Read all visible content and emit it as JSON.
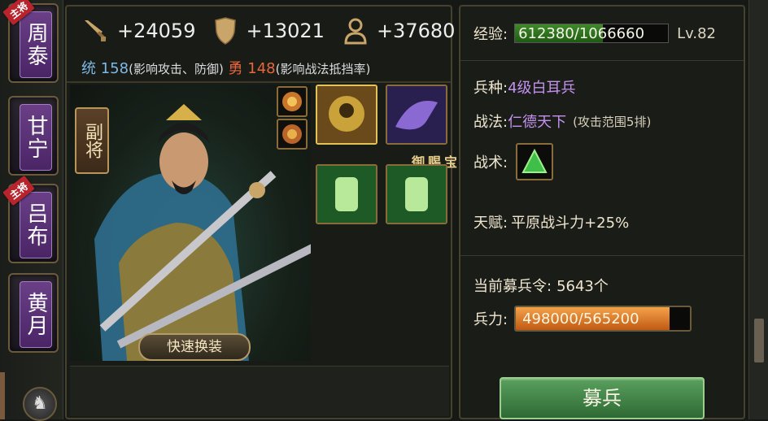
{
  "generals": [
    {
      "name": "周泰",
      "badge": "主将"
    },
    {
      "name": "甘宁",
      "badge": ""
    },
    {
      "name": "吕布",
      "badge": "主将"
    },
    {
      "name": "黄月",
      "badge": ""
    }
  ],
  "stats": {
    "attack": "+24059",
    "defense": "+13021",
    "troops": "+37680"
  },
  "attributes": {
    "lead_label": "统",
    "lead_value": "158",
    "lead_note": "(影响攻击、防御)",
    "brave_label": "勇",
    "brave_value": "148",
    "brave_note": "(影响战法抵挡率)"
  },
  "portrait": {
    "role": "副将",
    "quick_equip": "快速换装",
    "treasure_label": "御赐宝物"
  },
  "details": {
    "exp_label": "经验:",
    "exp_value": "612380/1066660",
    "exp_fraction": 0.574,
    "level": "Lv.82",
    "unit_label": "兵种:",
    "unit_value": "4级白耳兵",
    "skill_label": "战法:",
    "skill_value": "仁德天下",
    "skill_note": "(攻击范围5排)",
    "tactic_label": "战术:",
    "talent_label": "天赋:",
    "talent_value": "平原战斗力+25%",
    "recruit_orders_label": "当前募兵令:",
    "recruit_orders_value": "5643个",
    "troops_label": "兵力:",
    "troops_value": "498000/565200",
    "troops_fraction": 0.881,
    "recruit_button": "募兵"
  },
  "colors": {
    "accent_purple": "#c392ee",
    "recruit_green": "#4a8f4e",
    "troop_orange": "#e07a2a"
  }
}
